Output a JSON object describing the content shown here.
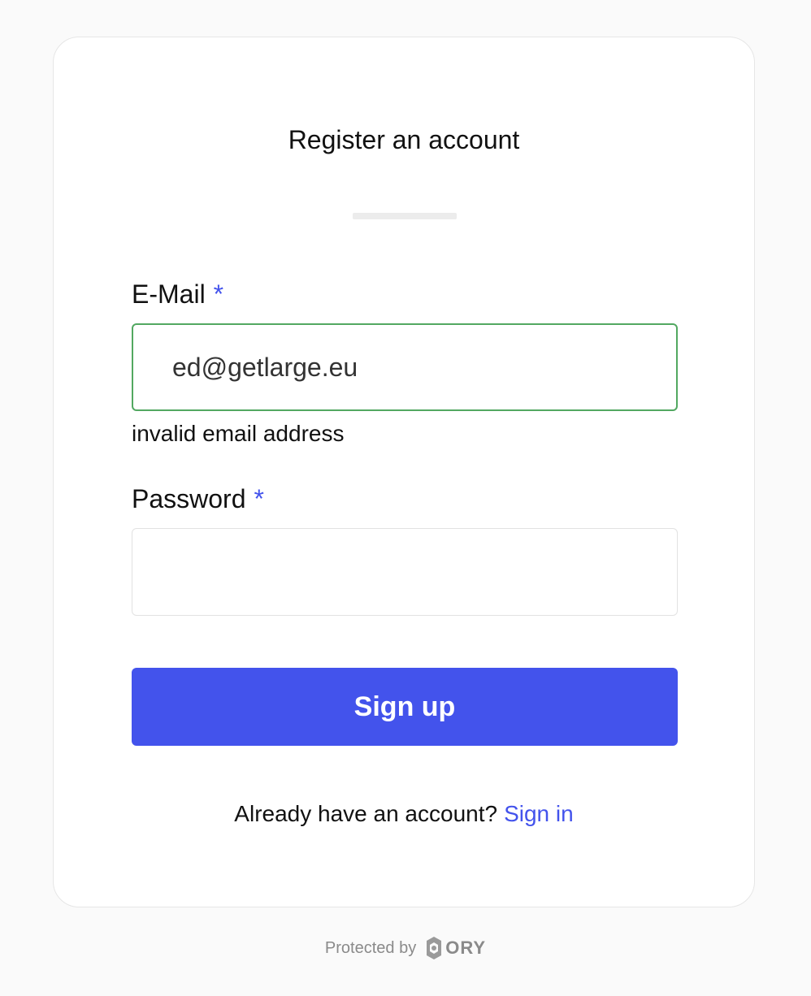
{
  "form": {
    "title": "Register an account",
    "email_label": "E-Mail",
    "email_required": "*",
    "email_value": "ed@getlarge.eu",
    "email_error": "invalid email address",
    "password_label": "Password",
    "password_required": "*",
    "password_value": "",
    "submit_label": "Sign up"
  },
  "footer": {
    "prompt": "Already have an account?",
    "signin_label": "Sign in"
  },
  "protected": {
    "text": "Protected by",
    "brand": "ORY"
  },
  "colors": {
    "accent": "#4353ec",
    "valid_border": "#52a861"
  }
}
